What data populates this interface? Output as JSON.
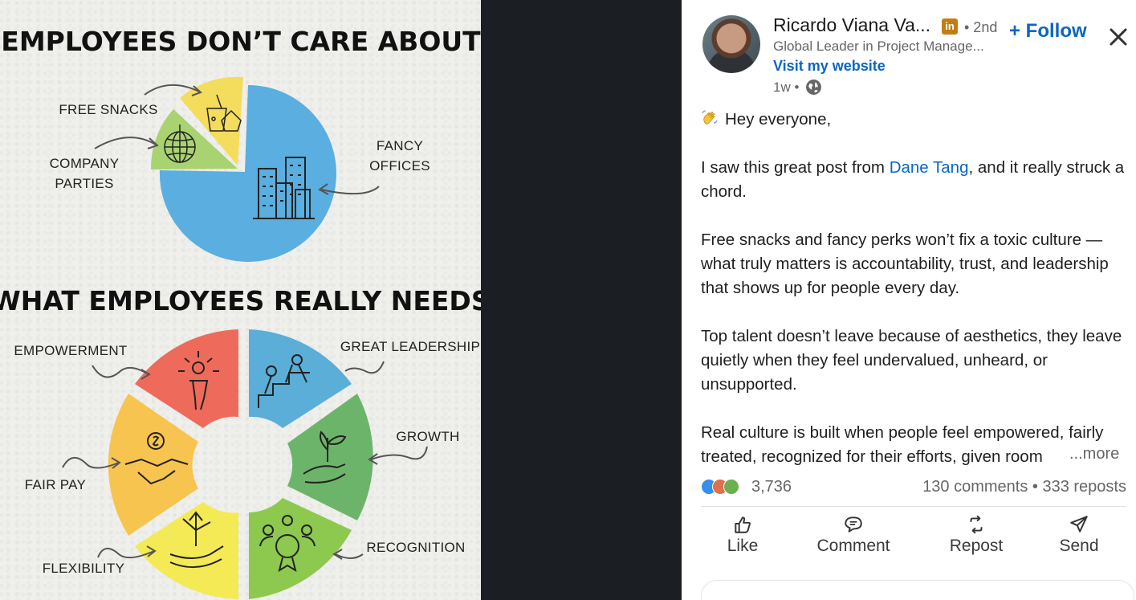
{
  "infographic": {
    "heading_top": "EMPLOYEES DON’T CARE ABOUT",
    "heading_bottom": "WHAT EMPLOYEES REALLY NEEDS",
    "pie_labels": {
      "free_snacks": "FREE SNACKS",
      "company_line1": "COMPANY",
      "company_line2": "PARTIES",
      "fancy_line1": "FANCY",
      "fancy_line2": "OFFICES"
    },
    "ring_labels": {
      "empowerment": "EMPOWERMENT",
      "great_leadership": "GREAT LEADERSHIP",
      "growth": "GROWTH",
      "fair_pay": "FAIR PAY",
      "recognition": "RECOGNITION",
      "flexibility": "FLEXIBILITY"
    },
    "colors": {
      "pie_blue": "#5aaee0",
      "pie_yellow": "#f4dc5c",
      "pie_green": "#a9d271",
      "ring_red": "#ee6b5b",
      "ring_blue": "#5aaed8",
      "ring_green": "#6db46b",
      "ring_green_light": "#8cc94e",
      "ring_yellow": "#f3ea55",
      "ring_orange": "#f7c44f"
    }
  },
  "post": {
    "author_name": "Ricardo Viana Va...",
    "degree": "• 2nd",
    "headline": "Global Leader in Project Manage...",
    "website_link": "Visit my website",
    "time": "1w •",
    "follow_label": "+ Follow",
    "body": {
      "greeting": "Hey everyone,",
      "p2_before": "I saw this great post from ",
      "p2_mention": "Dane Tang",
      "p2_after": ", and it really struck a chord.",
      "p3": "Free snacks and fancy perks won’t fix a toxic culture — what truly matters is accountability, trust, and leadership that shows up for people every day.",
      "p4": "Top talent doesn’t leave because of aesthetics, they leave quietly when they feel undervalued, unheard, or unsupported.",
      "p5": "Real culture is built when people feel empowered, fairly treated, recognized for their efforts, given room"
    },
    "see_more": "...more",
    "reaction_count": "3,736",
    "engagement": "130 comments • 333 reposts",
    "actions": {
      "like": "Like",
      "comment": "Comment",
      "repost": "Repost",
      "send": "Send"
    },
    "colors": {
      "link_blue": "#0a66c2",
      "badge_gold": "#c37d16"
    }
  }
}
